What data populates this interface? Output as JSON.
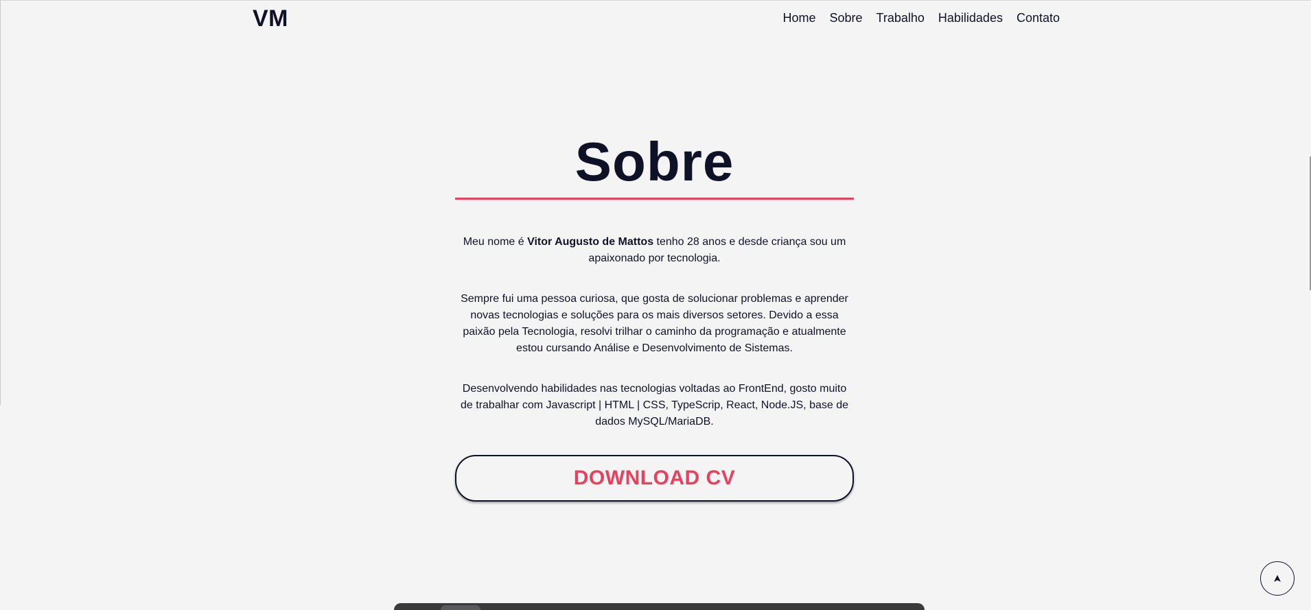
{
  "header": {
    "logo": "VM",
    "nav": [
      "Home",
      "Sobre",
      "Trabalho",
      "Habilidades",
      "Contato"
    ]
  },
  "about": {
    "title": "Sobre",
    "p1_before": "Meu nome é ",
    "p1_name": "Vitor Augusto de Mattos",
    "p1_after": " tenho 28 anos e desde criança sou um apaixonado por tecnologia.",
    "p2": "Sempre fui uma pessoa curiosa, que gosta de solucionar problemas e aprender novas tecnologias e soluções para os mais diversos setores. Devido a essa paixão pela Tecnologia, resolvi trilhar o caminho da programação e atualmente estou cursando Análise e Desenvolvimento de Sistemas.",
    "p3": "Desenvolvendo habilidades nas tecnologias voltadas ao FrontEnd, gosto muito de trabalhar com Javascript | HTML | CSS, TypeScrip, React, Node.JS, base de dados MySQL/MariaDB.",
    "download_label": "DOWNLOAD CV"
  },
  "scroll_top": {
    "icon": "arrow-up-icon"
  },
  "colors": {
    "background": "#f5f4f5",
    "text": "#0f1226",
    "accent": "#e8415d"
  }
}
